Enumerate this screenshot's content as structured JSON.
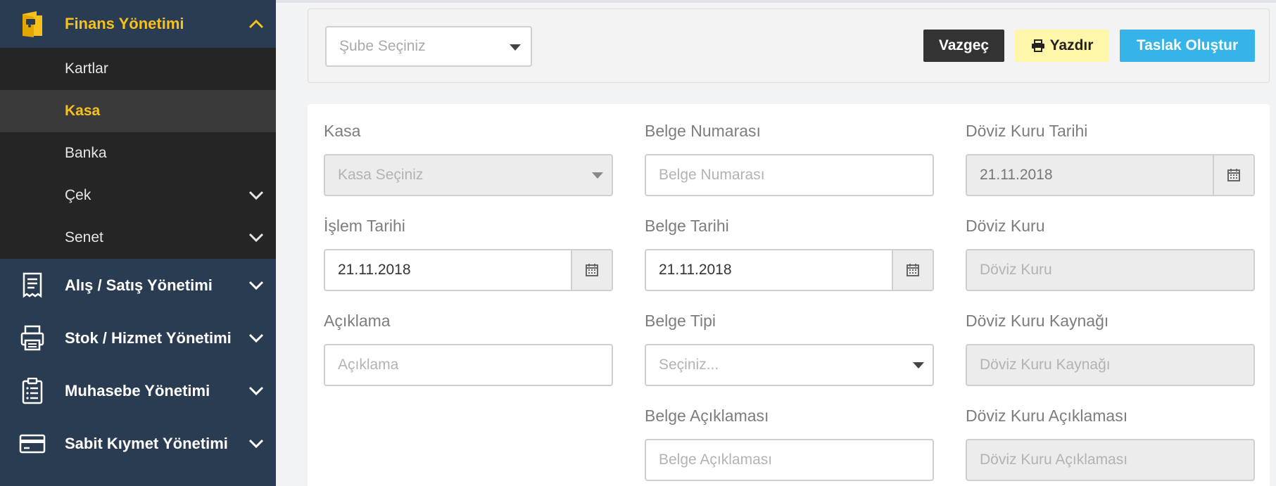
{
  "sidebar": {
    "finans": {
      "label": "Finans Yönetimi",
      "icon": "wallet-icon"
    },
    "submenu": [
      {
        "label": "Kartlar"
      },
      {
        "label": "Kasa"
      },
      {
        "label": "Banka"
      },
      {
        "label": "Çek"
      },
      {
        "label": "Senet"
      }
    ],
    "sections": [
      {
        "label": "Alış / Satış Yönetimi",
        "icon": "receipt-icon"
      },
      {
        "label": "Stok / Hizmet Yönetimi",
        "icon": "printer-stack-icon"
      },
      {
        "label": "Muhasebe Yönetimi",
        "icon": "clipboard-icon"
      },
      {
        "label": "Sabit Kıymet Yönetimi",
        "icon": "credit-card-icon"
      }
    ],
    "colors": {
      "background": "#2a3c51",
      "accent": "#f6c11c",
      "submenu_bg": "#252525"
    }
  },
  "toolbar": {
    "branch_placeholder": "Şube Seçiniz",
    "cancel_label": "Vazgeç",
    "print_label": "Yazdır",
    "draft_label": "Taslak Oluştur",
    "colors": {
      "cancel": "#333333",
      "print": "#fff6a9",
      "draft": "#36b4ea"
    }
  },
  "form": {
    "kasa": {
      "label": "Kasa",
      "placeholder": "Kasa Seçiniz"
    },
    "belge_numarasi": {
      "label": "Belge Numarası",
      "placeholder": "Belge Numarası"
    },
    "doviz_kuru_tarihi": {
      "label": "Döviz Kuru Tarihi",
      "value": "21.11.2018"
    },
    "islem_tarihi": {
      "label": "İşlem Tarihi",
      "value": "21.11.2018"
    },
    "belge_tarihi": {
      "label": "Belge Tarihi",
      "value": "21.11.2018"
    },
    "doviz_kuru": {
      "label": "Döviz Kuru",
      "placeholder": "Döviz Kuru"
    },
    "aciklama": {
      "label": "Açıklama",
      "placeholder": "Açıklama"
    },
    "belge_tipi": {
      "label": "Belge Tipi",
      "placeholder": "Seçiniz..."
    },
    "doviz_kuru_kaynagi": {
      "label": "Döviz Kuru Kaynağı",
      "placeholder": "Döviz Kuru Kaynağı"
    },
    "belge_aciklamasi": {
      "label": "Belge Açıklaması",
      "placeholder": "Belge Açıklaması"
    },
    "doviz_kuru_aciklamasi": {
      "label": "Döviz Kuru Açıklaması",
      "placeholder": "Döviz Kuru Açıklaması"
    }
  }
}
